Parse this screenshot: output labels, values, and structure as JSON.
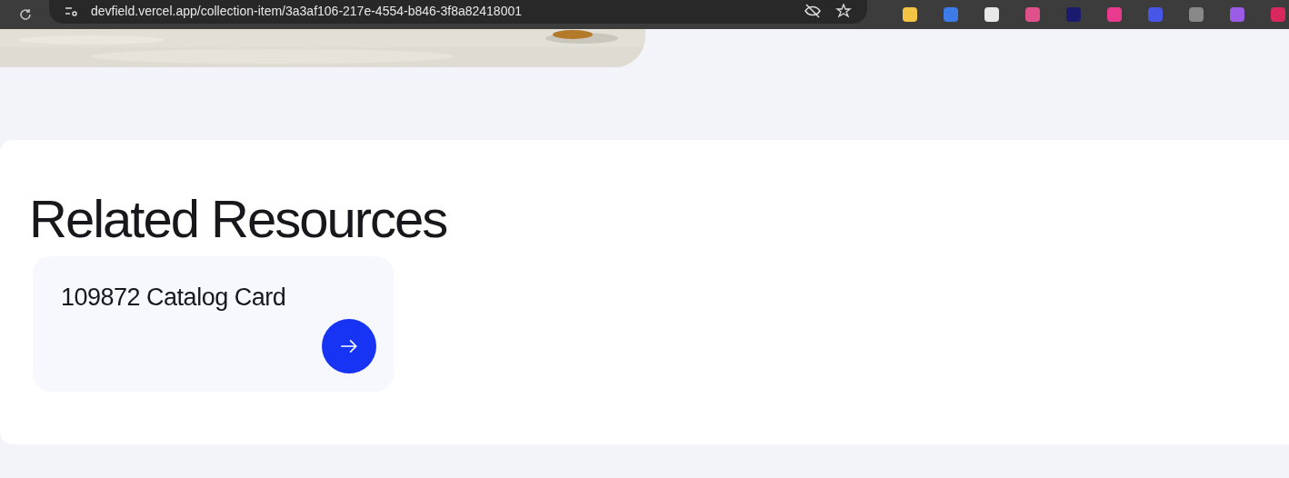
{
  "browser": {
    "url": "devfield.vercel.app/collection-item/3a3af106-217e-4554-b846-3f8a82418001"
  },
  "related": {
    "title": "Related Resources",
    "items": [
      {
        "title": "109872 Catalog Card"
      }
    ]
  }
}
